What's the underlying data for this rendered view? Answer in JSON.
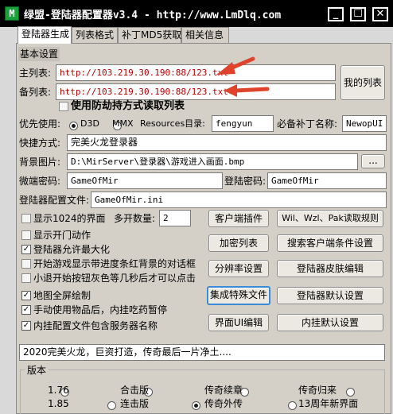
{
  "window": {
    "icon_letter": "M",
    "title": "绿盟-登陆器配置器v3.4 - http://www.LmDlq.com",
    "min_label": "_",
    "max_label": "☐",
    "close_label": "✕"
  },
  "tabs": [
    "登陆器生成",
    "列表格式",
    "补丁MD5获取",
    "相关信息"
  ],
  "basic_settings_label": "基本设置",
  "main_list": {
    "label": "主列表:",
    "value": "http://103.219.30.190:88/123.txt"
  },
  "backup_list": {
    "label": "备列表:",
    "value": "http://103.219.30.190:88/123.txt"
  },
  "my_list_button": "我的列表",
  "anti_hijack": {
    "label": "使用防劫持方式读取列表",
    "checked": false
  },
  "priority": {
    "label": "优先使用:",
    "options": [
      {
        "label": "D3D",
        "checked": true
      },
      {
        "label": "MMX",
        "checked": false
      }
    ]
  },
  "resources_dir": {
    "label": "Resources目录:",
    "value": "fengyun"
  },
  "patch_name": {
    "label": "必备补丁名称:",
    "value": "NewopUI"
  },
  "shortcut": {
    "label": "快捷方式:",
    "value": "完美火龙登录器"
  },
  "bg_image": {
    "label": "背景图片:",
    "value": "D:\\MirServer\\登录器\\游戏进入画面.bmp",
    "browse": "..."
  },
  "micro_password": {
    "label": "微端密码:",
    "value": "GameOfMir"
  },
  "login_password": {
    "label": "登陆密码:",
    "value": "GameOfMir"
  },
  "config_file": {
    "label": "登陆器配置文件:",
    "value": "GameOfMir.ini"
  },
  "options": [
    {
      "label": "显示1024的界面",
      "checked": false
    },
    {
      "label": "显示开门动作",
      "checked": false
    },
    {
      "label": "登陆器允许最大化",
      "checked": true
    },
    {
      "label": "开始游戏显示带进度条红背景的对话框",
      "checked": false
    },
    {
      "label": "小退开始按钮灰色等几秒后才可以点击",
      "checked": false
    },
    {
      "label": "地图全屏绘制",
      "checked": true
    },
    {
      "label": "手动使用物品后，内挂吃药暂停",
      "checked": true
    },
    {
      "label": "内挂配置文件包含服务器名称",
      "checked": true
    }
  ],
  "multi_open": {
    "label": "多开数量:",
    "value": "2"
  },
  "buttons_left": [
    "客户端插件",
    "加密列表",
    "分辨率设置",
    "集成特殊文件",
    "界面UI编辑"
  ],
  "buttons_right": [
    "Wil、Wzl、Pak读取规则",
    "搜索客户端条件设置",
    "登陆器皮肤编辑",
    "登陆器默认设置",
    "内挂默认设置"
  ],
  "notice": "2020完美火龙，巨资打造，传奇最后一片净土....",
  "version": {
    "label": "版本",
    "options": [
      {
        "label": "1.76",
        "checked": false
      },
      {
        "label": "合击版",
        "checked": false
      },
      {
        "label": "传奇续章",
        "checked": false
      },
      {
        "label": "传奇归来",
        "checked": false
      },
      {
        "label": "1.85",
        "checked": false
      },
      {
        "label": "连击版",
        "checked": true
      },
      {
        "label": "传奇外传",
        "checked": false
      },
      {
        "label": "13周年新界面",
        "checked": false
      }
    ]
  },
  "colors": {
    "title_bg": "#000000",
    "annotation_arrow": "#e0432b",
    "field_red_text": "#b30000"
  }
}
